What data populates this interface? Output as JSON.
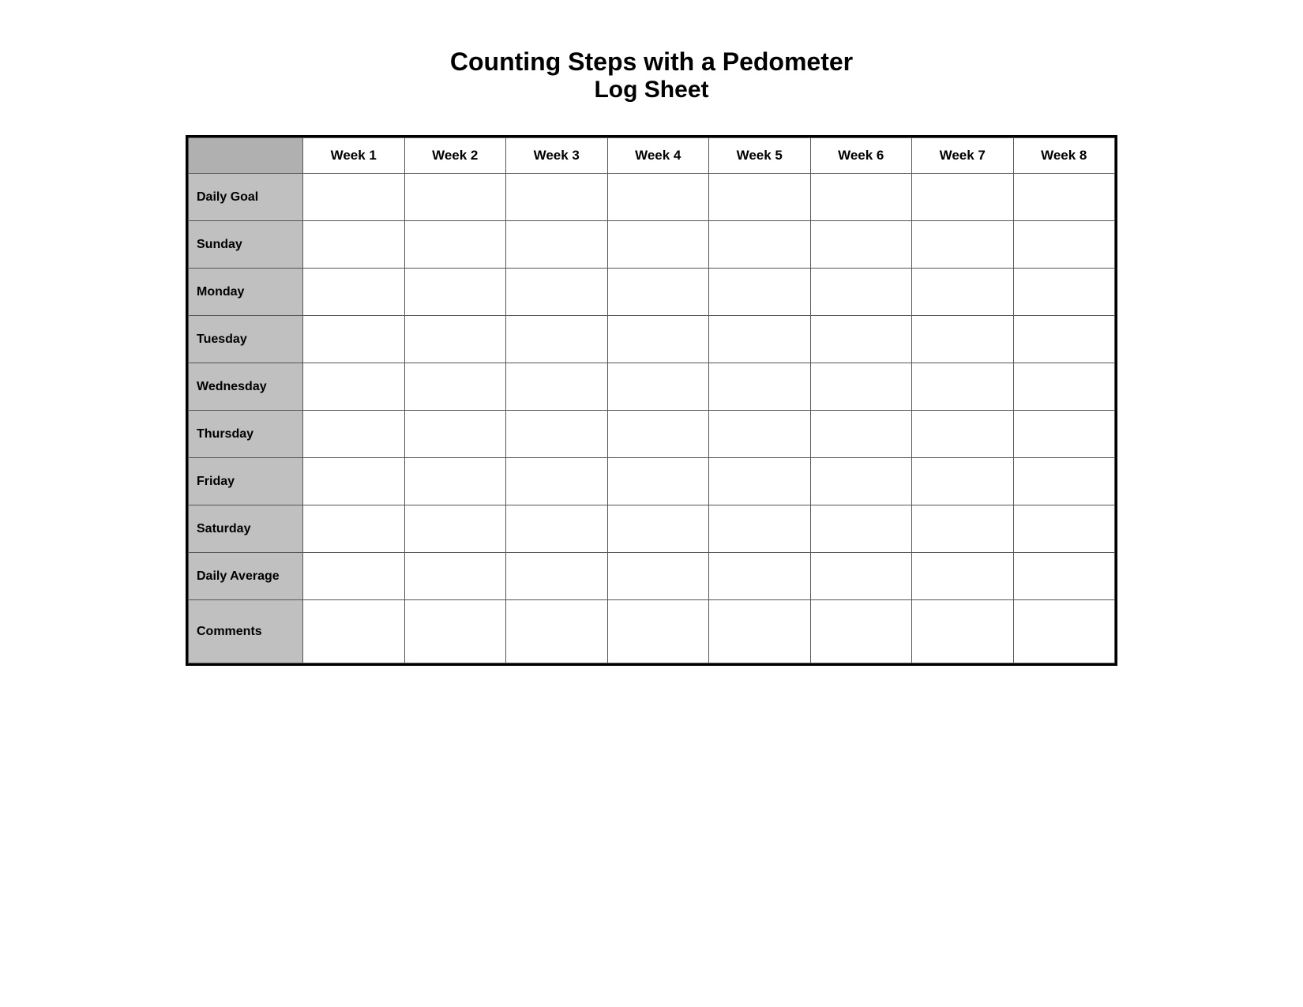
{
  "title": {
    "main": "Counting Steps with a Pedometer",
    "sub": "Log Sheet"
  },
  "table": {
    "header": {
      "empty": "",
      "columns": [
        "Week 1",
        "Week 2",
        "Week 3",
        "Week 4",
        "Week 5",
        "Week 6",
        "Week 7",
        "Week 8"
      ]
    },
    "rows": [
      {
        "label": "Daily Goal"
      },
      {
        "label": "Sunday"
      },
      {
        "label": "Monday"
      },
      {
        "label": "Tuesday"
      },
      {
        "label": "Wednesday"
      },
      {
        "label": "Thursday"
      },
      {
        "label": "Friday"
      },
      {
        "label": "Saturday"
      },
      {
        "label": "Daily Average"
      },
      {
        "label": "Comments"
      }
    ]
  }
}
